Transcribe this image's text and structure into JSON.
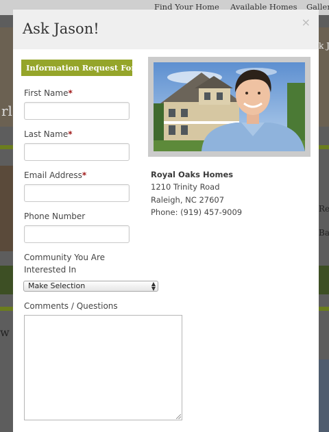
{
  "background_nav": {
    "items": [
      "Find Your Home",
      "Available Homes",
      "Galleri"
    ]
  },
  "background_fragments": {
    "right_top": "k J",
    "left_mid": "rl",
    "right_a": "Re",
    "right_b": "Ba",
    "left_low": "w"
  },
  "modal": {
    "title": "Ask Jason!",
    "close_label": "×",
    "form_heading": "Information Request Form",
    "fields": {
      "first_name_label": "First Name",
      "last_name_label": "Last Name",
      "email_label": "Email Address",
      "phone_label": "Phone Number",
      "community_label_line1": "Community You Are",
      "community_label_line2": "Interested In",
      "community_selected": "Make Selection",
      "comments_label": "Comments / Questions",
      "required_mark": "*",
      "first_name_value": "",
      "last_name_value": "",
      "email_value": "",
      "phone_value": "",
      "comments_value": ""
    },
    "contact": {
      "company": "Royal Oaks Homes",
      "street": "1210 Trinity Road",
      "city": "Raleigh, NC 27607",
      "phone": "Phone: (919) 457-9009"
    }
  },
  "colors": {
    "accent_green": "#95a52a",
    "required_red": "#a01818",
    "header_gray": "#efefef"
  }
}
